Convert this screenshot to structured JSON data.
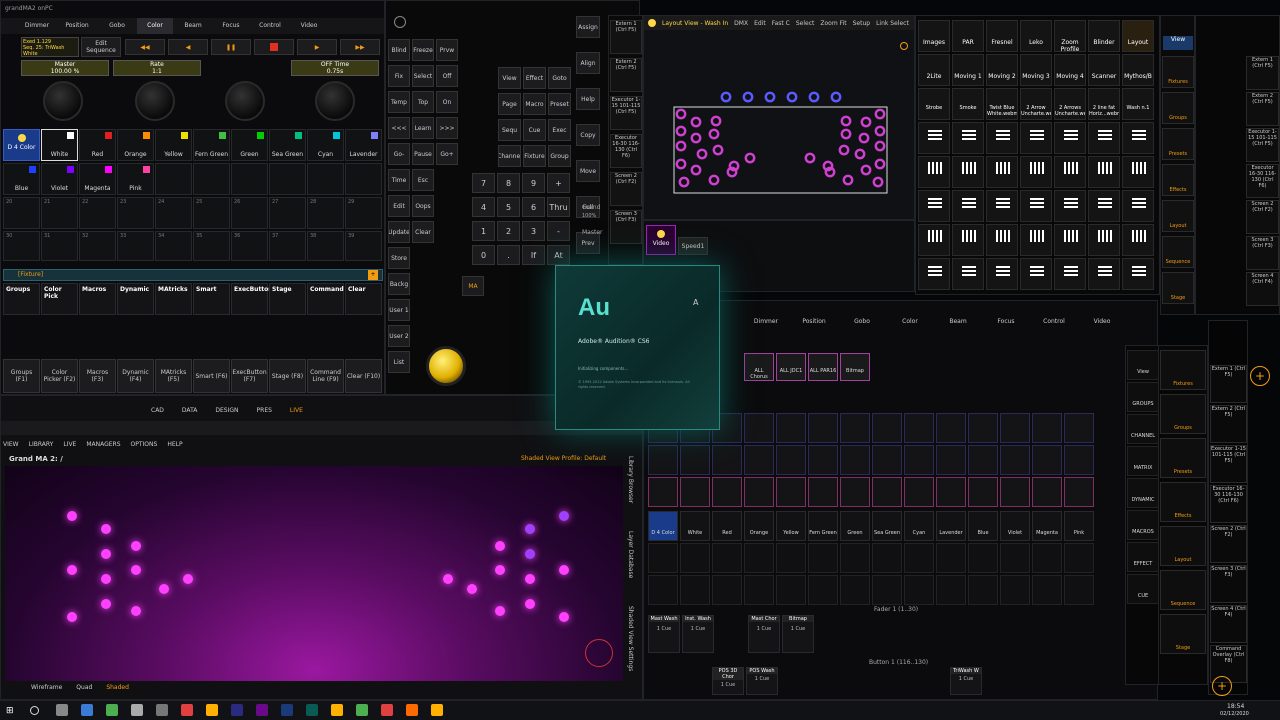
{
  "window_title": "grandMA2 onPC",
  "top_tabs": [
    "Dimmer",
    "Position",
    "Gobo",
    "Color",
    "Beam",
    "Focus",
    "Control",
    "Video"
  ],
  "sequence_panel": {
    "line1": "Exed 1.129",
    "line2": "Seq. 25: TriWash",
    "line3": "White",
    "edit_btn": "Edit Sequence"
  },
  "master": {
    "label": "Master",
    "value": "100.00 %"
  },
  "rate": {
    "label": "Rate",
    "value": "1:1"
  },
  "off_time": {
    "label": "OFF Time",
    "value": "0.75s"
  },
  "color_pool": {
    "head": "D 4 Color",
    "row1": [
      "White",
      "Red",
      "Orange",
      "Yellow",
      "Fern Green",
      "Green",
      "Sea Green",
      "Cyan",
      "Lavender"
    ],
    "row1_colors": [
      "#ffffff",
      "#e02020",
      "#ff8c00",
      "#f0e000",
      "#40c040",
      "#00d000",
      "#00c080",
      "#00c8d8",
      "#8080ff"
    ],
    "row2": [
      "Blue",
      "Violet",
      "Magenta",
      "Pink"
    ],
    "row2_colors": [
      "#2040ff",
      "#8000ff",
      "#ff00ff",
      "#ff40a0"
    ],
    "nums_row3": [
      "20",
      "21",
      "22",
      "23",
      "24",
      "25",
      "26",
      "27",
      "28",
      "29"
    ],
    "nums_row4": [
      "30",
      "31",
      "32",
      "33",
      "34",
      "35",
      "36",
      "37",
      "38",
      "39"
    ]
  },
  "command_keys": [
    [
      "Blind",
      "Freeze",
      "Prvw"
    ],
    [
      "Fix",
      "Select",
      "Off"
    ],
    [
      "Temp",
      "Top",
      "On"
    ],
    [
      "<<<",
      "Learn",
      ">>>"
    ],
    [
      "Go-",
      "Pause",
      "Go+"
    ],
    [
      "Time",
      "Esc",
      ""
    ],
    [
      "Edit",
      "Oops",
      ""
    ],
    [
      "Update",
      "Clear",
      ""
    ],
    [
      "Store",
      ""
    ],
    [
      "Backg",
      ""
    ],
    [
      "User 1",
      ""
    ],
    [
      "User 2",
      ""
    ],
    [
      "List",
      ""
    ]
  ],
  "view_keys": [
    [
      "View",
      "Effect",
      "Goto"
    ],
    [
      "Page",
      "Macro",
      "Preset"
    ],
    [
      "Sequ",
      "Cue",
      "Exec"
    ],
    [
      "Channel",
      "Fixture",
      "Group"
    ]
  ],
  "numpad": [
    [
      "7",
      "8",
      "9",
      "+"
    ],
    [
      "4",
      "5",
      "6",
      "Thru"
    ],
    [
      "1",
      "2",
      "3",
      "-"
    ],
    [
      "0",
      ".",
      "If",
      "At"
    ]
  ],
  "right_col_keys": [
    "Assign",
    "Align",
    "Help",
    "Copy",
    "Move",
    "Full",
    "Prev",
    "Set",
    "Next",
    "Down"
  ],
  "ma_label": "MA",
  "grand_label": "Grand",
  "grand_value": "100%",
  "master_label": "Master",
  "fixture_bar": "[Fixture]",
  "preset_tabs": [
    "Groups",
    "Color Pick",
    "Macros",
    "Dynamic",
    "MAtricks",
    "Smart",
    "ExecButton",
    "Stage",
    "Command",
    "Clear"
  ],
  "bottom_tabs": [
    "Groups (F1)",
    "Color Picker (F2)",
    "Macros (F3)",
    "Dynamic (F4)",
    "MAtricks (F5)",
    "Smart (F6)",
    "ExecButton (F7)",
    "Stage (F8)",
    "Command Line (F9)",
    "Clear (F10)"
  ],
  "layout_view": {
    "title": "Layout View - Wash In",
    "tabs": [
      "DMX",
      "Edit",
      "Fast C",
      "Select",
      "Zoom Fit",
      "Setup",
      "Link Select"
    ]
  },
  "video_cells": [
    "Video",
    "Speed1"
  ],
  "layout_buttons": [
    "Images",
    "PAR",
    "Fresnel",
    "Leko",
    "Zoom Profile",
    "Blinder",
    "Layout",
    "View"
  ],
  "layout_row2": [
    "2Lite",
    "Moving 1",
    "Moving 2",
    "Moving 3",
    "Moving 4",
    "Scanner",
    "Mythos/B"
  ],
  "layout_row3": [
    "Strobe",
    "Smoke",
    "Twist Blue White.webm",
    "2 Arrow Uncharte.webm",
    "2 Arrows Uncharte.webm",
    "2 line fat Horiz...webm",
    "Wash n.1"
  ],
  "right_sidebar": [
    "Fixtures",
    "Groups",
    "Presets",
    "Effects",
    "Layout",
    "Sequence",
    "Stage"
  ],
  "exec_sidebar": [
    "Extern 1 (Ctrl F5)",
    "Extern 2 (Ctrl F5)",
    "Executor 1-15 101-115 (Ctrl F5)",
    "Executor 16-30 116-130 (Ctrl F6)",
    "Screen 2 (Ctrl F2)",
    "Screen 3 (Ctrl F3)",
    "Screen 4 (Ctrl F4)",
    "Command Overlay (Ctrl F8)"
  ],
  "audition": {
    "logo": "Au",
    "product": "Adobe® Audition® CS6",
    "status": "Initializing components...",
    "copyright": "© 1992-2012 Adobe Systems Incorporated and its licensors. All rights reserved."
  },
  "lower_tabs": [
    "Dimmer",
    "Position",
    "Gobo",
    "Color",
    "Beam",
    "Focus",
    "Control",
    "Video"
  ],
  "lower_layout_cells": [
    "ALL Chorus",
    "ALL JDC1",
    "ALL PAR16",
    "Bitmap"
  ],
  "lower_right_side": [
    "View",
    "GROUPS",
    "CHANNEL",
    "MATRIX",
    "DYNAMIC",
    "MACROS",
    "EFFECT",
    "CUE"
  ],
  "lower_color_row": [
    "D 4 Color",
    "White",
    "Red",
    "Orange",
    "Yellow",
    "Fern Green",
    "Green",
    "Sea Green",
    "Cyan",
    "Lavender",
    "Blue",
    "Violet",
    "Magenta",
    "Pink"
  ],
  "fader_label": "Fader 1 (1..30)",
  "button_label": "Button 1 (116..130)",
  "execs": [
    {
      "title": "Mast Wash",
      "cue": "1 Cue"
    },
    {
      "title": "Inst. Wash",
      "cue": "1 Cue"
    },
    {
      "title": "Mast Chor",
      "cue": "1 Cue"
    },
    {
      "title": "Bitmap",
      "cue": "1 Cue"
    }
  ],
  "execs_bottom": [
    {
      "title": "POS 3D Chor",
      "cue": "1 Cue"
    },
    {
      "title": "POS Wash",
      "cue": "1 Cue"
    },
    {
      "title": "TriWash W",
      "cue": "1 Cue"
    }
  ],
  "capture_menus": [
    "CAD",
    "DATA",
    "DESIGN",
    "PRES",
    "LIVE"
  ],
  "capture_menu2": [
    "VIEW",
    "LIBRARY",
    "LIVE",
    "MANAGERS",
    "OPTIONS",
    "HELP"
  ],
  "capture_title": "Grand MA 2: /",
  "shaded_profile": "Shaded View Profile: Default",
  "capture_side": [
    "Library Browser",
    "Layer Database",
    "Shaded View Settings"
  ],
  "capture_modes": [
    "Wireframe",
    "Quad",
    "Shaded"
  ],
  "taskbar": {
    "time": "18:54",
    "date": "02/12/2020"
  }
}
